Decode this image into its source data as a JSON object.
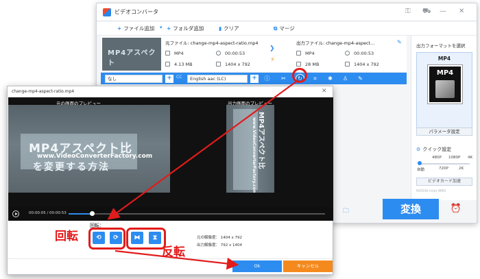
{
  "app": {
    "title": "ビデオコンバータ",
    "toolbar": {
      "add_file": "ファイル追加",
      "add_folder": "フォルダ追加",
      "clear": "クリア",
      "merge": "マージ"
    },
    "file": {
      "source_label": "元ファイル: change-mp4-aspect-ratio.mp4",
      "output_label": "出力ファイル: change-mp4-aspect...",
      "thumb_text": "MP4アスペクト",
      "source": {
        "format": "MP4",
        "duration": "00:00:53",
        "size": "4.13 MB",
        "resolution": "1404 x 792"
      },
      "output": {
        "format": "MP4",
        "duration": "00:00:53",
        "size": "28 MB",
        "resolution": "1404 x 792"
      }
    },
    "editbar": {
      "subtitle": "なし",
      "cc": "CC",
      "audio": "English aac (LC)"
    },
    "right_panel": {
      "format_label": "出力フォーマットを選択",
      "format": "MP4",
      "format_box": "MP4",
      "param_button": "パラメータ設定",
      "quick_label": "クイック設定",
      "quality_top": [
        "480P",
        "1080P",
        "4K"
      ],
      "quality_bottom": [
        "自動",
        "720P",
        "2K"
      ],
      "gpu_button": "ビデオカード加速",
      "gpu_vendors": "NVIDIA   Intel   AMD"
    },
    "convert": "変換",
    "colors": {
      "accent": "#2d8cf0",
      "cancel": "#f48a1e",
      "annotation": "#e21b1b"
    }
  },
  "dialog": {
    "title": "change-mp4-aspect-ratio.mp4",
    "preview_original": "元の画面のプレビュー",
    "preview_output": "出力画面のプレビュー",
    "video_title": "MP4アスペクト比",
    "video_url": "www.VideoConverterFactory.com",
    "video_sub": "を変更する方法",
    "time": "00:00:05 / 00:00:53",
    "progress": 0.09,
    "rotate_label": "回転：",
    "original_res": "元の解像度：  1404 x 792",
    "output_res": "出力解像度：  792 x 1404",
    "ok": "Ok",
    "cancel": "キャンセル"
  },
  "annotations": {
    "rotate": "回転",
    "flip": "反転"
  }
}
